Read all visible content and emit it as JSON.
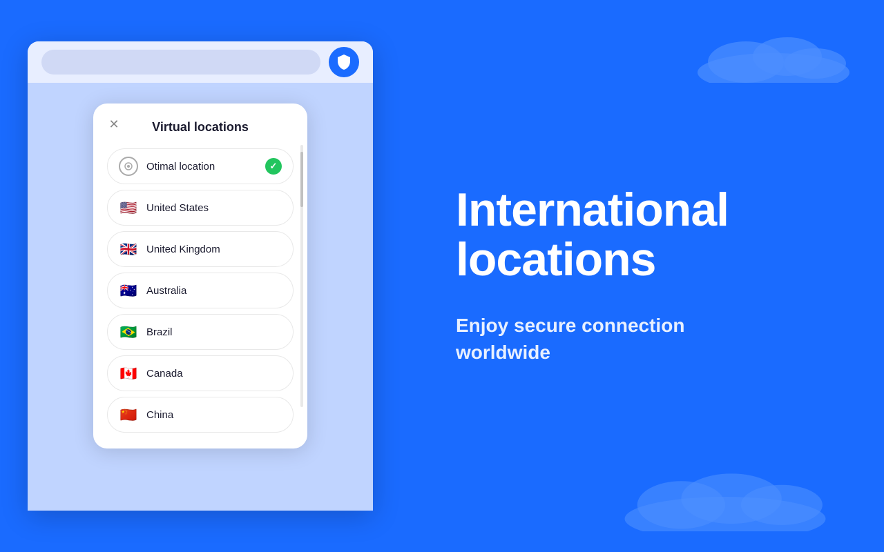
{
  "app": {
    "background_color": "#1a6bff"
  },
  "modal": {
    "title": "Virtual locations",
    "close_label": "×",
    "locations": [
      {
        "id": "optimal",
        "name": "Otimal location",
        "flag_type": "optimal",
        "selected": true
      },
      {
        "id": "us",
        "name": "United States",
        "flag_type": "us",
        "selected": false
      },
      {
        "id": "uk",
        "name": "United Kingdom",
        "flag_type": "uk",
        "selected": false
      },
      {
        "id": "au",
        "name": "Australia",
        "flag_type": "au",
        "selected": false
      },
      {
        "id": "br",
        "name": "Brazil",
        "flag_type": "br",
        "selected": false
      },
      {
        "id": "ca",
        "name": "Canada",
        "flag_type": "ca",
        "selected": false
      },
      {
        "id": "cn",
        "name": "China",
        "flag_type": "cn",
        "selected": false
      }
    ]
  },
  "right_panel": {
    "headline": "International\nlocations",
    "subheadline": "Enjoy secure connection worldwide"
  },
  "icons": {
    "shield": "🛡",
    "close": "✕",
    "check": "✓",
    "optimal_symbol": "◎"
  },
  "flags": {
    "us": "🇺🇸",
    "uk": "🇬🇧",
    "au": "🇦🇺",
    "br": "🇧🇷",
    "ca": "🇨🇦",
    "cn": "🇨🇳"
  }
}
